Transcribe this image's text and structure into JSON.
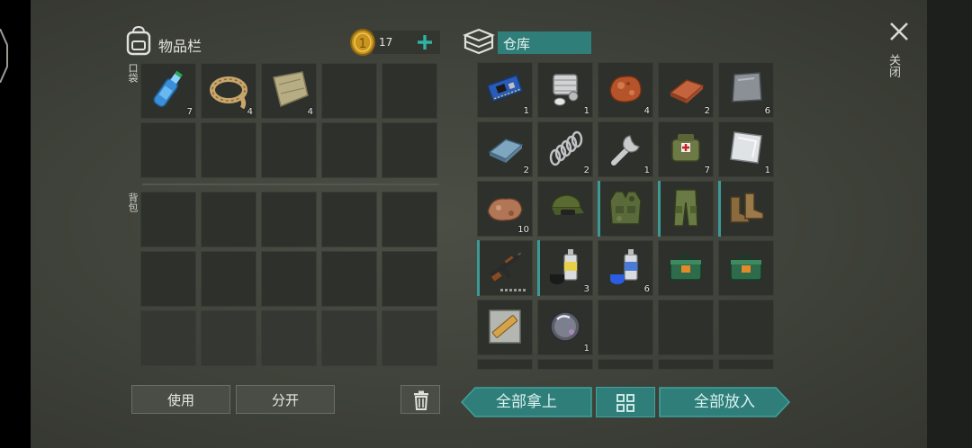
{
  "inventory": {
    "title": "物品栏",
    "coins": "17",
    "pocket_label": "口袋",
    "backpack_label": "背包"
  },
  "storage": {
    "title": "仓库"
  },
  "pocket_items": [
    {
      "name": "water-bottle",
      "count": "7"
    },
    {
      "name": "rope",
      "count": "4"
    },
    {
      "name": "cloth",
      "count": "4"
    }
  ],
  "storage_items": [
    {
      "name": "circuit-board",
      "count": "1"
    },
    {
      "name": "engine-part",
      "count": "1"
    },
    {
      "name": "copper-ore",
      "count": "4"
    },
    {
      "name": "copper-ingot",
      "count": "2"
    },
    {
      "name": "metal-plate",
      "count": "6"
    },
    {
      "name": "iron-ingot",
      "count": "2"
    },
    {
      "name": "spring",
      "count": "2"
    },
    {
      "name": "wrench",
      "count": "1"
    },
    {
      "name": "medical-bag",
      "count": "7"
    },
    {
      "name": "steel-sheet",
      "count": "1"
    },
    {
      "name": "iron-ore",
      "count": "10"
    },
    {
      "name": "military-cap",
      "count": ""
    },
    {
      "name": "camo-vest",
      "count": ""
    },
    {
      "name": "camo-pants",
      "count": ""
    },
    {
      "name": "boots",
      "count": ""
    },
    {
      "name": "assault-rifle",
      "count": ""
    },
    {
      "name": "spray-can-black",
      "count": "3"
    },
    {
      "name": "spray-can-blue",
      "count": "6"
    },
    {
      "name": "ammo-box-1",
      "count": ""
    },
    {
      "name": "ammo-box-2",
      "count": ""
    },
    {
      "name": "blueprint",
      "count": ""
    },
    {
      "name": "glass-lens",
      "count": "1"
    }
  ],
  "buttons": {
    "use": "使用",
    "split": "分开",
    "take_all": "全部拿上",
    "put_all": "全部放入",
    "close": "关闭"
  },
  "colors": {
    "accent": "#2f7e79",
    "panel_bg": "#3f423a",
    "slot_bg": "#2d302b"
  }
}
